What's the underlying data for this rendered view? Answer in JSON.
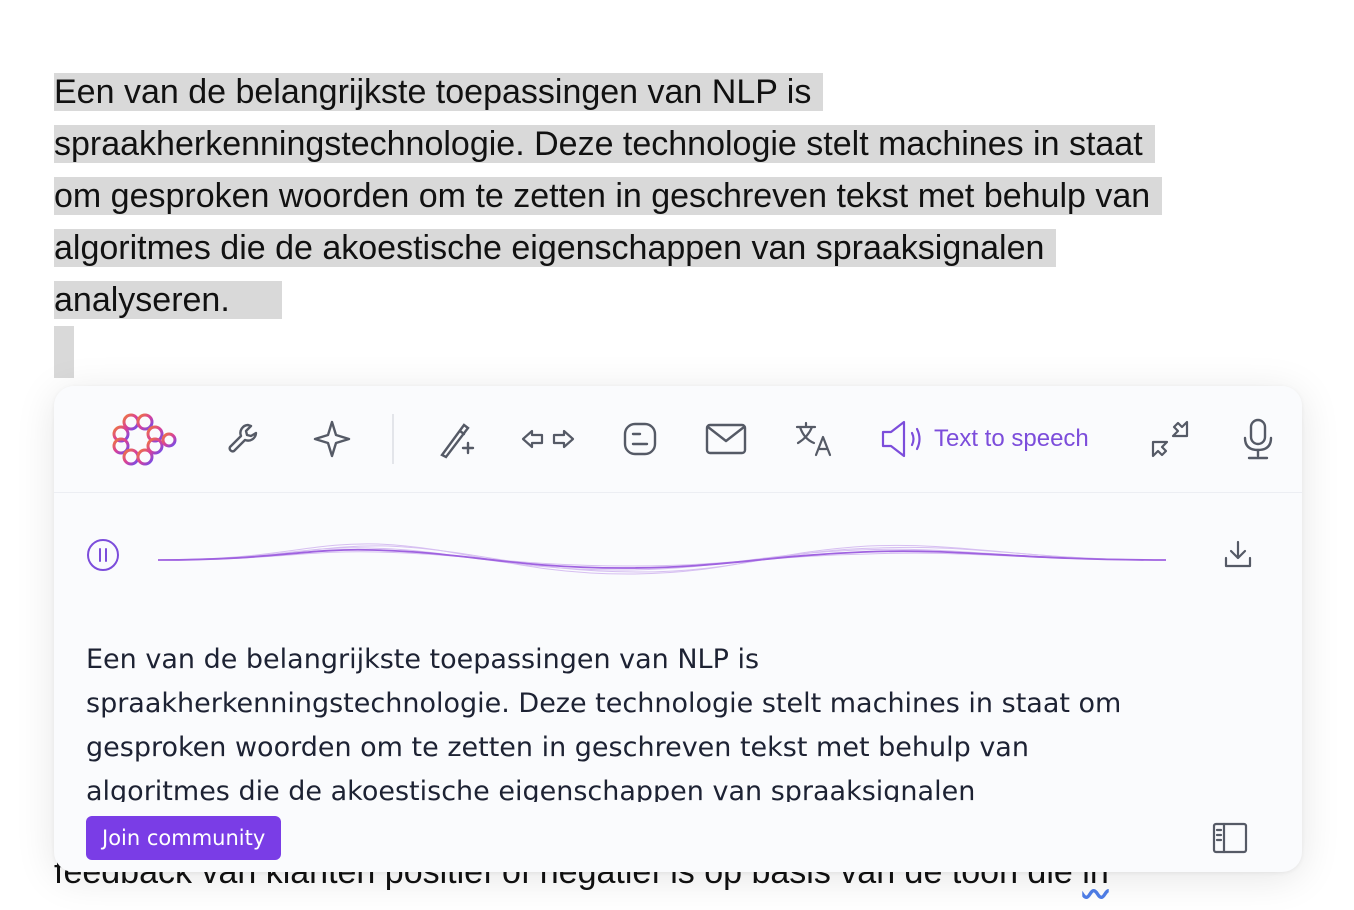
{
  "document": {
    "selected_lines": [
      "Een van de belangrijkste toepassingen van NLP is",
      "spraakherkenningstechnologie. Deze technologie stelt machines in staat",
      "om gesproken woorden om te zetten in geschreven tekst met behulp van",
      "algoritmes die de akoestische eigenschappen van spraaksignalen",
      "analyseren."
    ],
    "partial_line_before": "feedback van klanten positief of negatief is op basis van de toon die ",
    "partial_line_flagged_word": "in"
  },
  "toolbar": {
    "items": [
      {
        "name": "app-logo",
        "icon": "brain-logo-icon"
      },
      {
        "name": "tools",
        "icon": "wrench-icon"
      },
      {
        "name": "ai-magic",
        "icon": "sparkle-icon"
      },
      {
        "name": "rewrite",
        "icon": "magic-wand-icon"
      },
      {
        "name": "compare",
        "icon": "arrows-left-right-icon"
      },
      {
        "name": "blog",
        "icon": "blogger-icon"
      },
      {
        "name": "email",
        "icon": "envelope-icon"
      },
      {
        "name": "translate",
        "icon": "translate-icon"
      },
      {
        "name": "text-to-speech",
        "icon": "speaker-icon"
      },
      {
        "name": "minimize",
        "icon": "collapse-arrows-icon"
      },
      {
        "name": "voice-input",
        "icon": "microphone-icon"
      }
    ],
    "tts_label": "Text to speech"
  },
  "player": {
    "state": "playing",
    "pause_icon": "pause-icon",
    "download_icon": "download-icon"
  },
  "result": {
    "lines": [
      "Een van de belangrijkste toepassingen van NLP is",
      "spraakherkenningstechnologie. Deze technologie stelt machines in staat om",
      "gesproken woorden om te zetten in geschreven tekst met behulp van",
      "algoritmes die de akoestische eigenschappen van spraaksignalen"
    ]
  },
  "footer": {
    "join_label": "Join community",
    "sidebar_icon": "sidebar-toggle-icon"
  },
  "colors": {
    "accent": "#7a3de6",
    "tts_active": "#7c4ddb",
    "selection": "#d9d9d9",
    "icon_gray": "#555a66"
  }
}
